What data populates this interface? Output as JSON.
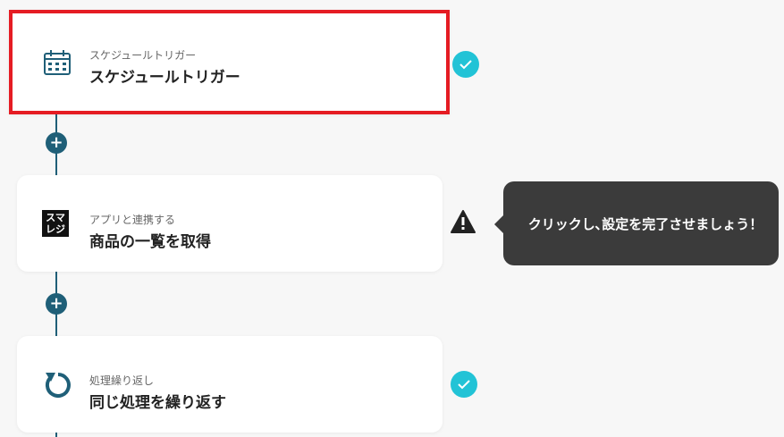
{
  "steps": [
    {
      "subtitle": "スケジュールトリガー",
      "title": "スケジュールトリガー",
      "icon": "calendar-icon",
      "status": "complete"
    },
    {
      "subtitle": "アプリと連携する",
      "title": "商品の一覧を取得",
      "icon": "smaregi-logo-icon",
      "icon_text_top": "スマ",
      "icon_text_bottom": "レジ",
      "status": "warning"
    },
    {
      "subtitle": "処理繰り返し",
      "title": "同じ処理を繰り返す",
      "icon": "loop-icon",
      "status": "complete"
    }
  ],
  "add_step_label": "+",
  "tooltip": {
    "text": "クリックし､設定を完了させましょう！"
  },
  "colors": {
    "accent": "#1f5f78",
    "check": "#22c3d6",
    "selected_border": "#e51c23",
    "tooltip_bg": "#3b3b3b"
  }
}
